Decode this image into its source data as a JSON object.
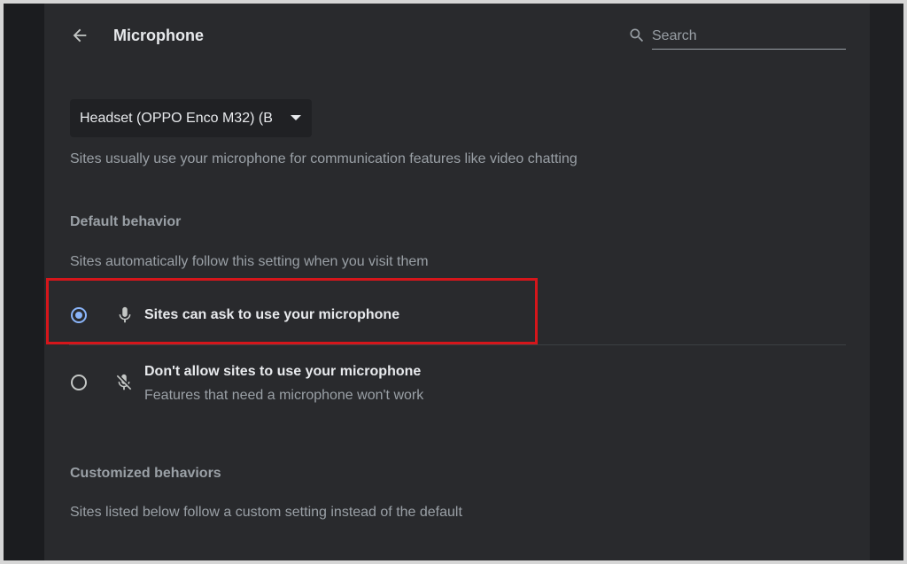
{
  "header": {
    "title": "Microphone",
    "back_icon": "arrow-left-icon"
  },
  "search": {
    "placeholder": "Search",
    "value": "",
    "icon": "search-icon"
  },
  "device_select": {
    "selected": "Headset (OPPO Enco M32) (B"
  },
  "description": "Sites usually use your microphone for communication features like video chatting",
  "default_behavior": {
    "heading": "Default behavior",
    "subtext": "Sites automatically follow this setting when you visit them",
    "options": [
      {
        "label": "Sites can ask to use your microphone",
        "sublabel": "",
        "icon": "microphone-icon",
        "selected": true
      },
      {
        "label": "Don't allow sites to use your microphone",
        "sublabel": "Features that need a microphone won't work",
        "icon": "microphone-off-icon",
        "selected": false
      }
    ]
  },
  "customized_behaviors": {
    "heading": "Customized behaviors",
    "subtext": "Sites listed below follow a custom setting instead of the default"
  },
  "colors": {
    "background": "#292a2d",
    "accent": "#8ab4f8",
    "highlight": "#d5161b",
    "text_primary": "#e8eaed",
    "text_secondary": "#9aa0a6"
  }
}
